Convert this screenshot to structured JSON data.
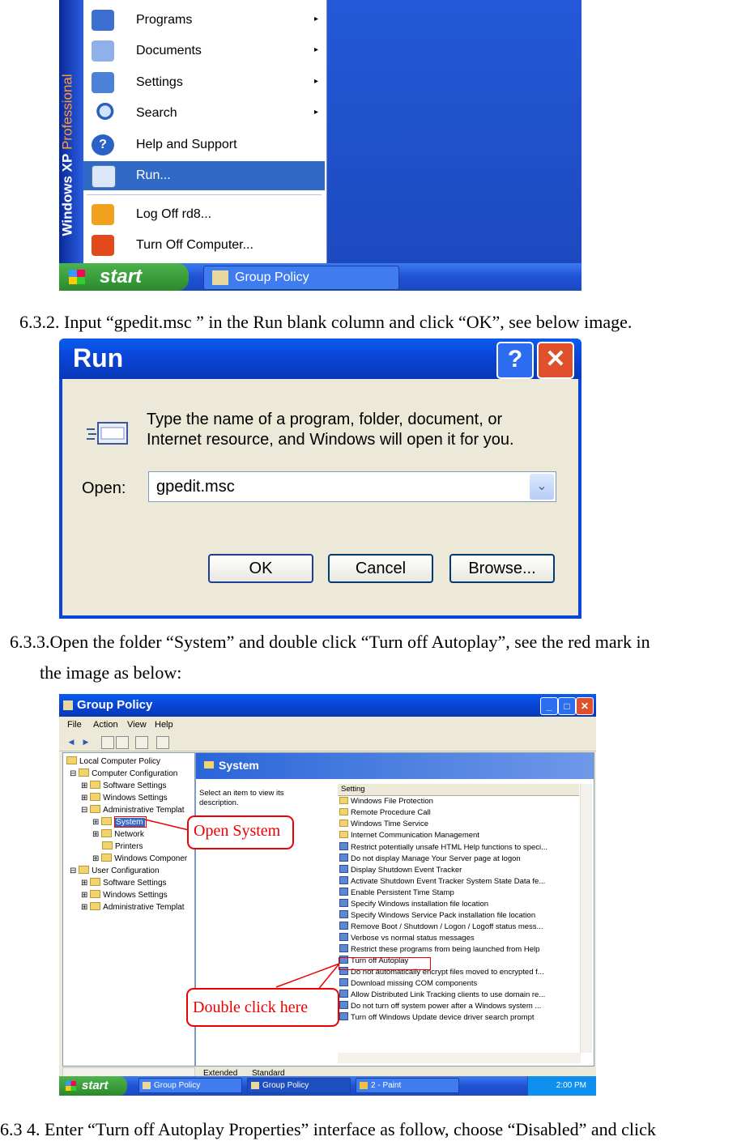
{
  "start_menu": {
    "band_label_bold": "Windows XP",
    "band_label_light": "Professional",
    "items": [
      {
        "label": "Programs",
        "arrow": "▸"
      },
      {
        "label": "Documents",
        "arrow": "▸"
      },
      {
        "label": "Settings",
        "arrow": "▸"
      },
      {
        "label": "Search",
        "arrow": "▸"
      },
      {
        "label": "Help and Support",
        "arrow": ""
      },
      {
        "label": "Run...",
        "arrow": ""
      }
    ],
    "bottom_items": [
      "Log Off rd8...",
      "Turn Off Computer..."
    ],
    "start_label": "start",
    "taskbar_item": "Group Policy"
  },
  "captions": {
    "c1": "6.3.2. Input “gpedit.msc ” in the Run blank column and click “OK”, see below image.",
    "c2_line1": "6.3.3.Open the folder “System” and double click “Turn off Autoplay”, see the red mark in",
    "c2_line2": "the image as below:",
    "c3": "6.3 4. Enter  “Turn off Autoplay Properties” interface as follow, choose “Disabled” and click"
  },
  "run_dialog": {
    "title": "Run",
    "help_btn": "?",
    "close_btn": "✕",
    "prompt_line1": "Type the name of a program, folder, document, or",
    "prompt_line2": "Internet resource, and Windows will open it for you.",
    "open_label": "Open:",
    "open_value": "gpedit.msc",
    "dropdown_arrow": "⌄",
    "ok": "OK",
    "cancel": "Cancel",
    "browse": "Browse..."
  },
  "group_policy": {
    "title": "Group Policy",
    "menu": [
      "File",
      "Action",
      "View",
      "Help"
    ],
    "tree": [
      "Local Computer Policy",
      "Computer Configuration",
      "Software Settings",
      "Windows Settings",
      "Administrative Templat",
      "System",
      "Network",
      "Printers",
      "Windows Componer",
      "User Configuration",
      "Software Settings",
      "Windows Settings",
      "Administrative Templat"
    ],
    "right_title": "System",
    "description": "Select an item to view its description.",
    "column_header": "Setting",
    "settings": [
      {
        "label": "Windows File Protection",
        "kind": "folder"
      },
      {
        "label": "Remote Procedure Call",
        "kind": "folder"
      },
      {
        "label": "Windows Time Service",
        "kind": "folder"
      },
      {
        "label": "Internet Communication Management",
        "kind": "folder"
      },
      {
        "label": "Restrict potentially unsafe HTML Help functions to speci...",
        "kind": "setting"
      },
      {
        "label": "Do not display Manage Your Server page at logon",
        "kind": "setting"
      },
      {
        "label": "Display Shutdown Event Tracker",
        "kind": "setting"
      },
      {
        "label": "Activate Shutdown Event Tracker System State Data fe...",
        "kind": "setting"
      },
      {
        "label": "Enable Persistent Time Stamp",
        "kind": "setting"
      },
      {
        "label": "Specify Windows installation file location",
        "kind": "setting"
      },
      {
        "label": "Specify Windows Service Pack installation file location",
        "kind": "setting"
      },
      {
        "label": "Remove Boot / Shutdown / Logon / Logoff status mess...",
        "kind": "setting"
      },
      {
        "label": "Verbose vs normal status messages",
        "kind": "setting"
      },
      {
        "label": "Restrict these programs from being launched from Help",
        "kind": "setting"
      },
      {
        "label": "Turn off Autoplay",
        "kind": "setting"
      },
      {
        "label": "Do not automatically encrypt files moved to encrypted f...",
        "kind": "setting"
      },
      {
        "label": "Download missing COM components",
        "kind": "setting"
      },
      {
        "label": "Allow Distributed Link Tracking clients to use domain re...",
        "kind": "setting"
      },
      {
        "label": "Do not turn off system power after a Windows system ...",
        "kind": "setting"
      },
      {
        "label": "Turn off Windows Update device driver search prompt",
        "kind": "setting"
      }
    ],
    "tabs": [
      "Extended",
      "Standard"
    ],
    "start_label": "start",
    "taskbar_items": [
      "Group Policy",
      "Group Policy",
      "2 - Paint"
    ],
    "clock": "2:00 PM",
    "annotation_open": "Open System",
    "annotation_double": "Double click here"
  }
}
